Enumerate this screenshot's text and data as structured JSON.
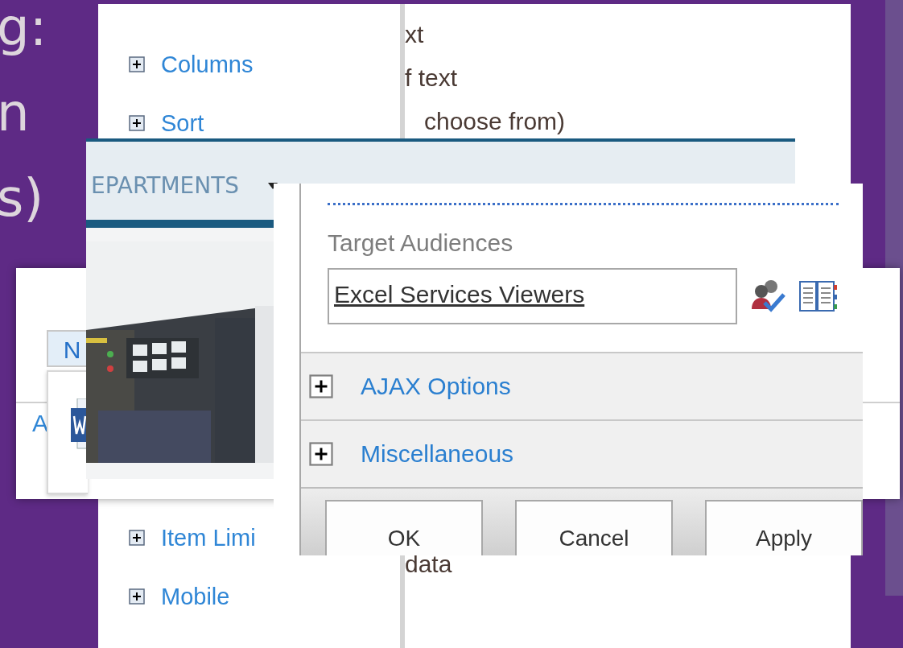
{
  "slide": {
    "heading_fragments": [
      "g:",
      "n",
      "s)"
    ]
  },
  "settings_page": {
    "sections": [
      {
        "label": "Columns",
        "expanded": false
      },
      {
        "label": "Sort",
        "expanded": false
      },
      {
        "label": "Item Limi",
        "expanded": false
      },
      {
        "label": "Mobile",
        "expanded": false
      }
    ],
    "description_lines": [
      "xt",
      "f text",
      "choose from)",
      "data"
    ]
  },
  "list_view": {
    "button": "N",
    "link": "A"
  },
  "site_nav": {
    "items": [
      {
        "label": "EPARTMENTS",
        "dropdown": true
      }
    ]
  },
  "web_part_panel": {
    "audience_label": "Target Audiences",
    "audience_value": "Excel Services Viewers",
    "sections": [
      {
        "label": "AJAX Options",
        "expanded": false
      },
      {
        "label": "Miscellaneous",
        "expanded": false
      }
    ],
    "buttons": [
      "OK",
      "Cancel",
      "Apply"
    ]
  }
}
